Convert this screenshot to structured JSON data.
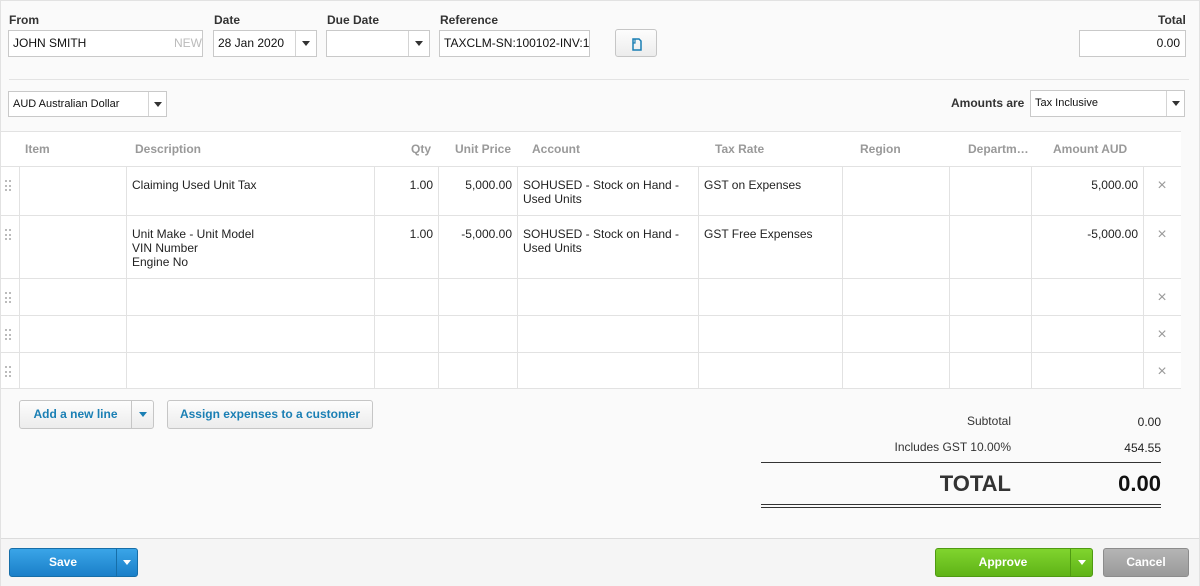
{
  "header": {
    "from_label": "From",
    "from_value": "JOHN SMITH",
    "from_badge": "NEW",
    "date_label": "Date",
    "date_value": "28 Jan 2020",
    "due_label": "Due Date",
    "due_value": "",
    "ref_label": "Reference",
    "ref_value": "TAXCLM-SN:100102-INV:1",
    "total_label": "Total",
    "total_value": "0.00"
  },
  "currency": {
    "value": "AUD Australian Dollar"
  },
  "amounts": {
    "label": "Amounts are",
    "value": "Tax Inclusive"
  },
  "columns": [
    "Item",
    "Description",
    "Qty",
    "Unit Price",
    "Account",
    "Tax Rate",
    "Region",
    "Departm…",
    "Amount AUD"
  ],
  "rows": [
    {
      "item": "",
      "description": "Claiming Used Unit Tax",
      "qty": "1.00",
      "unit_price": "5,000.00",
      "account": "SOHUSED - Stock on Hand -\nUsed Units",
      "tax_rate": "GST on Expenses",
      "region": "",
      "department": "",
      "amount": "5,000.00"
    },
    {
      "item": "",
      "description": "Unit Make - Unit Model\nVIN Number\nEngine No",
      "qty": "1.00",
      "unit_price": "-5,000.00",
      "account": "SOHUSED - Stock on Hand -\nUsed Units",
      "tax_rate": "GST Free Expenses",
      "region": "",
      "department": "",
      "amount": "-5,000.00"
    },
    {
      "item": "",
      "description": "",
      "qty": "",
      "unit_price": "",
      "account": "",
      "tax_rate": "",
      "region": "",
      "department": "",
      "amount": ""
    },
    {
      "item": "",
      "description": "",
      "qty": "",
      "unit_price": "",
      "account": "",
      "tax_rate": "",
      "region": "",
      "department": "",
      "amount": ""
    },
    {
      "item": "",
      "description": "",
      "qty": "",
      "unit_price": "",
      "account": "",
      "tax_rate": "",
      "region": "",
      "department": "",
      "amount": ""
    }
  ],
  "actions": {
    "add_line": "Add a new line",
    "assign": "Assign expenses to a customer"
  },
  "totals": {
    "subtotal_label": "Subtotal",
    "subtotal_value": "0.00",
    "gst_label": "Includes GST 10.00%",
    "gst_value": "454.55",
    "total_label": "TOTAL",
    "total_value": "0.00"
  },
  "footer": {
    "save": "Save",
    "approve": "Approve",
    "cancel": "Cancel"
  },
  "colors": {
    "save": "#1f8dd6",
    "approve": "#6cc31d",
    "cancel": "#a5a5a5",
    "link": "#1a7fb4"
  }
}
